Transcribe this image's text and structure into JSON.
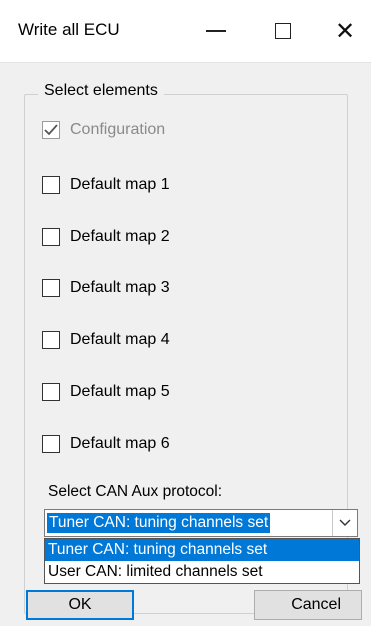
{
  "window": {
    "title": "Write all ECU",
    "minimize_icon": "minimize-icon",
    "maximize_icon": "maximize-icon",
    "close_symbol": "✕"
  },
  "group": {
    "label": "Select elements",
    "items": [
      {
        "label": "Configuration",
        "checked": true,
        "disabled": true
      },
      {
        "label": "Default map 1",
        "checked": false,
        "disabled": false
      },
      {
        "label": "Default map 2",
        "checked": false,
        "disabled": false
      },
      {
        "label": "Default map 3",
        "checked": false,
        "disabled": false
      },
      {
        "label": "Default map 4",
        "checked": false,
        "disabled": false
      },
      {
        "label": "Default map 5",
        "checked": false,
        "disabled": false
      },
      {
        "label": "Default map 6",
        "checked": false,
        "disabled": false
      }
    ]
  },
  "protocol": {
    "label": "Select CAN Aux protocol:",
    "selected": "Tuner CAN: tuning channels set",
    "options": [
      "Tuner CAN: tuning channels set",
      "User CAN: limited channels set"
    ]
  },
  "buttons": {
    "ok": "OK",
    "cancel": "Cancel"
  },
  "colors": {
    "accent": "#0078d7"
  }
}
